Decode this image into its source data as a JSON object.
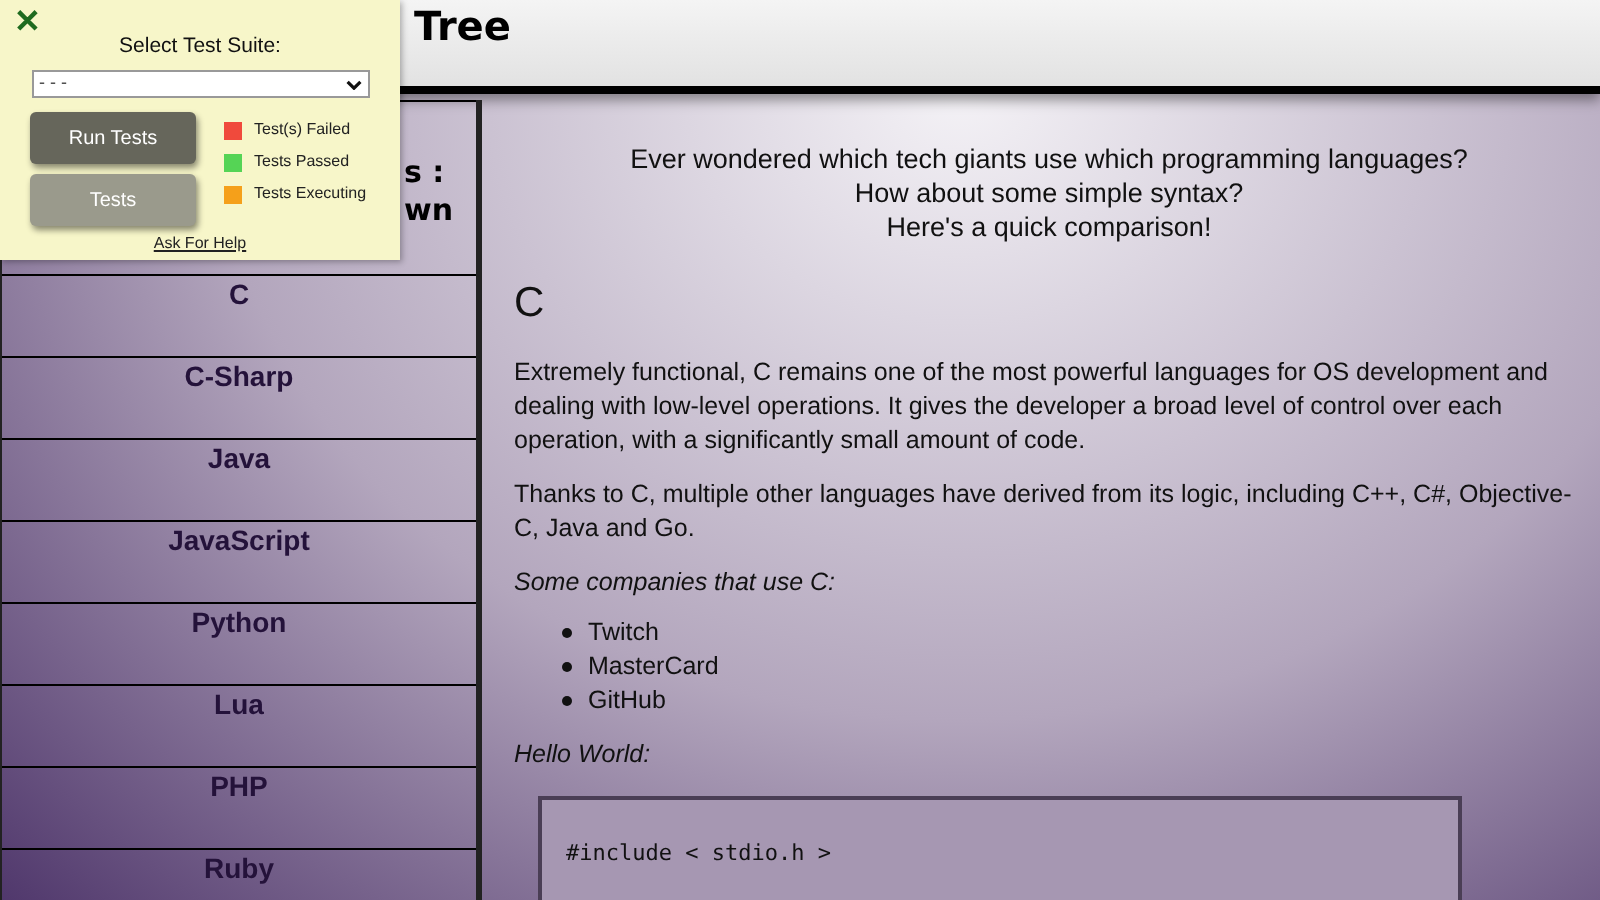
{
  "header": {
    "title": "Tree"
  },
  "sidebar": {
    "heading": [
      "s :",
      "wn"
    ],
    "items": [
      "C",
      "C-Sharp",
      "Java",
      "JavaScript",
      "Python",
      "Lua",
      "PHP",
      "Ruby"
    ]
  },
  "intro": [
    "Ever wondered which tech giants use which programming languages?",
    "How about some simple syntax?",
    "Here's a quick comparison!"
  ],
  "article": {
    "heading": "C",
    "paragraphs": [
      "Extremely functional, C remains one of the most powerful languages for OS development and dealing with low-level operations. It gives the developer a broad level of control over each operation, with a significantly small amount of code.",
      "Thanks to C, multiple other languages have derived from its logic, including C++, C#, Objective-C, Java and Go."
    ],
    "companies_label": "Some companies that use C:",
    "companies": [
      "Twitch",
      "MasterCard",
      "GitHub"
    ],
    "hello_label": "Hello World:",
    "code": "#include < stdio.h >"
  },
  "test_panel": {
    "close": "✕",
    "select_label": "Select Test Suite:",
    "select_value": "- - -",
    "buttons": [
      "Run Tests",
      "Tests"
    ],
    "legend": [
      {
        "label": "Test(s) Failed",
        "color": "#f04a3c"
      },
      {
        "label": "Tests Passed",
        "color": "#55d455"
      },
      {
        "label": "Tests Executing",
        "color": "#f5a01a"
      }
    ],
    "help_link": "Ask For Help"
  }
}
